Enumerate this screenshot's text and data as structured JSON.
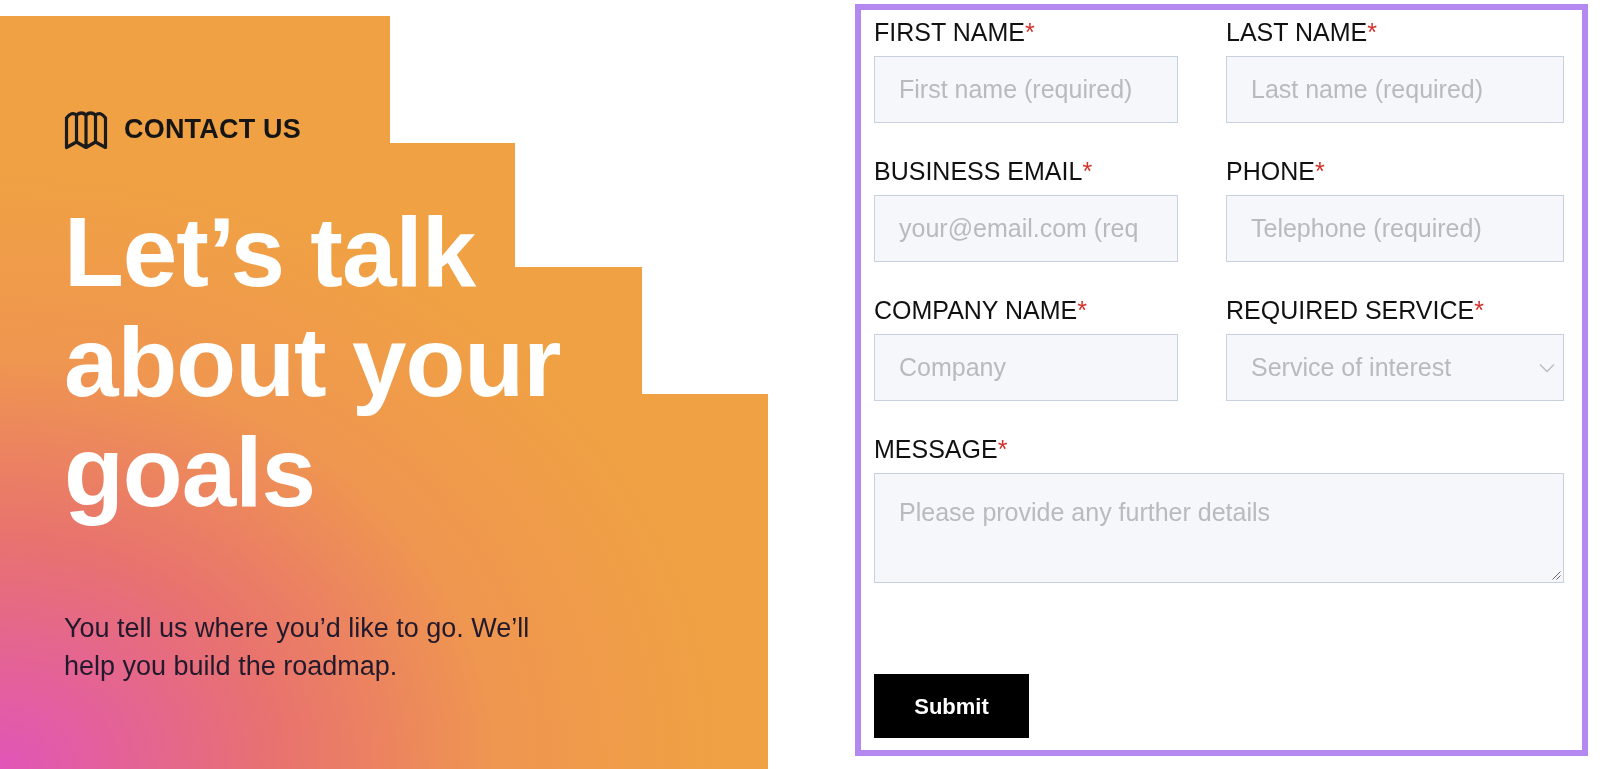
{
  "hero": {
    "eyebrow": "CONTACT US",
    "heading": "Let’s talk about your goals",
    "intro": "You tell us where you’d like to go. We’ll help you build the roadmap."
  },
  "form": {
    "fields": [
      {
        "kind": "text",
        "label": "FIRST NAME",
        "required_mark": "*",
        "placeholder": "First name (required)"
      },
      {
        "kind": "text",
        "label": "LAST NAME",
        "required_mark": "*",
        "placeholder": "Last name (required)"
      },
      {
        "kind": "text",
        "label": "BUSINESS EMAIL",
        "required_mark": "*",
        "placeholder": "your@email.com (req"
      },
      {
        "kind": "text",
        "label": "PHONE",
        "required_mark": "*",
        "placeholder": "Telephone (required)"
      },
      {
        "kind": "text",
        "label": "COMPANY NAME",
        "required_mark": "*",
        "placeholder": "Company"
      },
      {
        "kind": "select",
        "label": "REQUIRED SERVICE",
        "required_mark": "*",
        "placeholder": "Service of interest"
      },
      {
        "kind": "textarea",
        "label": "MESSAGE",
        "required_mark": "*",
        "placeholder": "Please provide any further details"
      }
    ],
    "submit": "Submit"
  }
}
